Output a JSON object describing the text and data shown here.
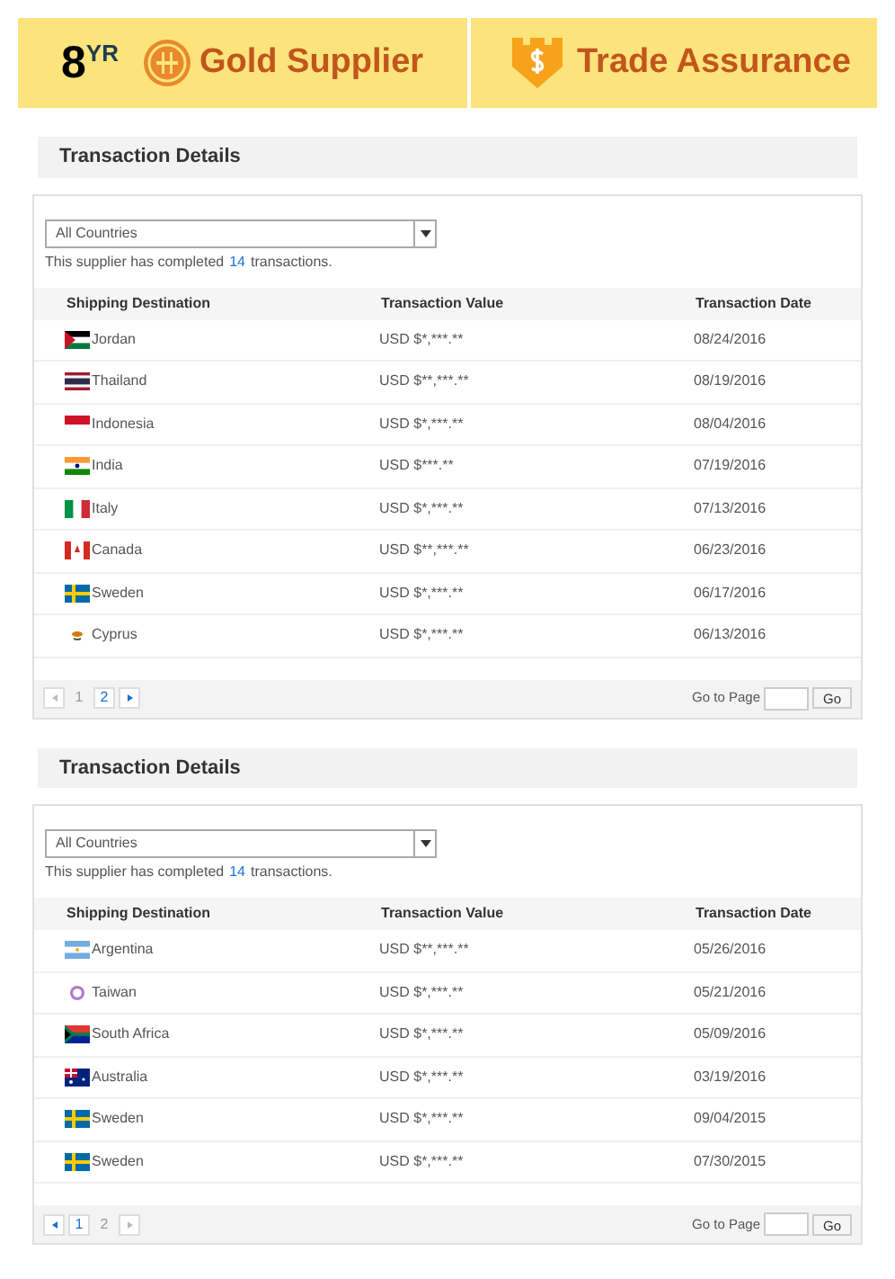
{
  "banner": {
    "years": "8",
    "years_unit": "YR",
    "gold_supplier": "Gold Supplier",
    "trade_assurance": "Trade Assurance"
  },
  "sections": [
    {
      "title": "Transaction Details",
      "filter": {
        "value": "All Countries"
      },
      "summary": {
        "before": "This supplier has completed",
        "count": "14",
        "after": "transactions."
      },
      "columns": [
        "Shipping Destination",
        "Transaction Value",
        "Transaction Date"
      ],
      "rows": [
        {
          "kind": "jordan",
          "country": "Jordan",
          "value": "USD $*,***.**",
          "date": "08/24/2016"
        },
        {
          "kind": "thailand",
          "country": "Thailand",
          "value": "USD $**,***.**",
          "date": "08/19/2016"
        },
        {
          "kind": "indonesia",
          "country": "Indonesia",
          "value": "USD $*,***.**",
          "date": "08/04/2016"
        },
        {
          "kind": "india",
          "country": "India",
          "value": "USD $***.**",
          "date": "07/19/2016"
        },
        {
          "kind": "italy",
          "country": "Italy",
          "value": "USD $*,***.**",
          "date": "07/13/2016"
        },
        {
          "kind": "canada",
          "country": "Canada",
          "value": "USD $**,***.**",
          "date": "06/23/2016"
        },
        {
          "kind": "sweden",
          "country": "Sweden",
          "value": "USD $*,***.**",
          "date": "06/17/2016"
        },
        {
          "kind": "cyprus",
          "country": "Cyprus",
          "value": "USD $*,***.**",
          "date": "06/13/2016"
        }
      ],
      "pager": {
        "prev_disabled": true,
        "next_disabled": false,
        "pages": [
          {
            "label": "1",
            "selected": false
          },
          {
            "label": "2",
            "selected": true
          }
        ],
        "goto_label": "Go to Page",
        "go": "Go"
      }
    },
    {
      "title": "Transaction Details",
      "filter": {
        "value": "All Countries"
      },
      "summary": {
        "before": "This supplier has completed",
        "count": "14",
        "after": "transactions."
      },
      "columns": [
        "Shipping Destination",
        "Transaction Value",
        "Transaction Date"
      ],
      "rows": [
        {
          "kind": "argentina",
          "country": "Argentina",
          "value": "USD $**,***.**",
          "date": "05/26/2016"
        },
        {
          "kind": "taiwan",
          "country": "Taiwan",
          "value": "USD $*,***.**",
          "date": "05/21/2016"
        },
        {
          "kind": "southafrica",
          "country": "South Africa",
          "value": "USD $*,***.**",
          "date": "05/09/2016"
        },
        {
          "kind": "australia",
          "country": "Australia",
          "value": "USD $*,***.**",
          "date": "03/19/2016"
        },
        {
          "kind": "sweden",
          "country": "Sweden",
          "value": "USD $*,***.**",
          "date": "09/04/2015"
        },
        {
          "kind": "sweden",
          "country": "Sweden",
          "value": "USD $*,***.**",
          "date": "07/30/2015"
        }
      ],
      "pager": {
        "prev_disabled": false,
        "next_disabled": true,
        "pages": [
          {
            "label": "1",
            "selected": true
          },
          {
            "label": "2",
            "selected": false
          }
        ],
        "goto_label": "Go to Page",
        "go": "Go"
      }
    }
  ]
}
